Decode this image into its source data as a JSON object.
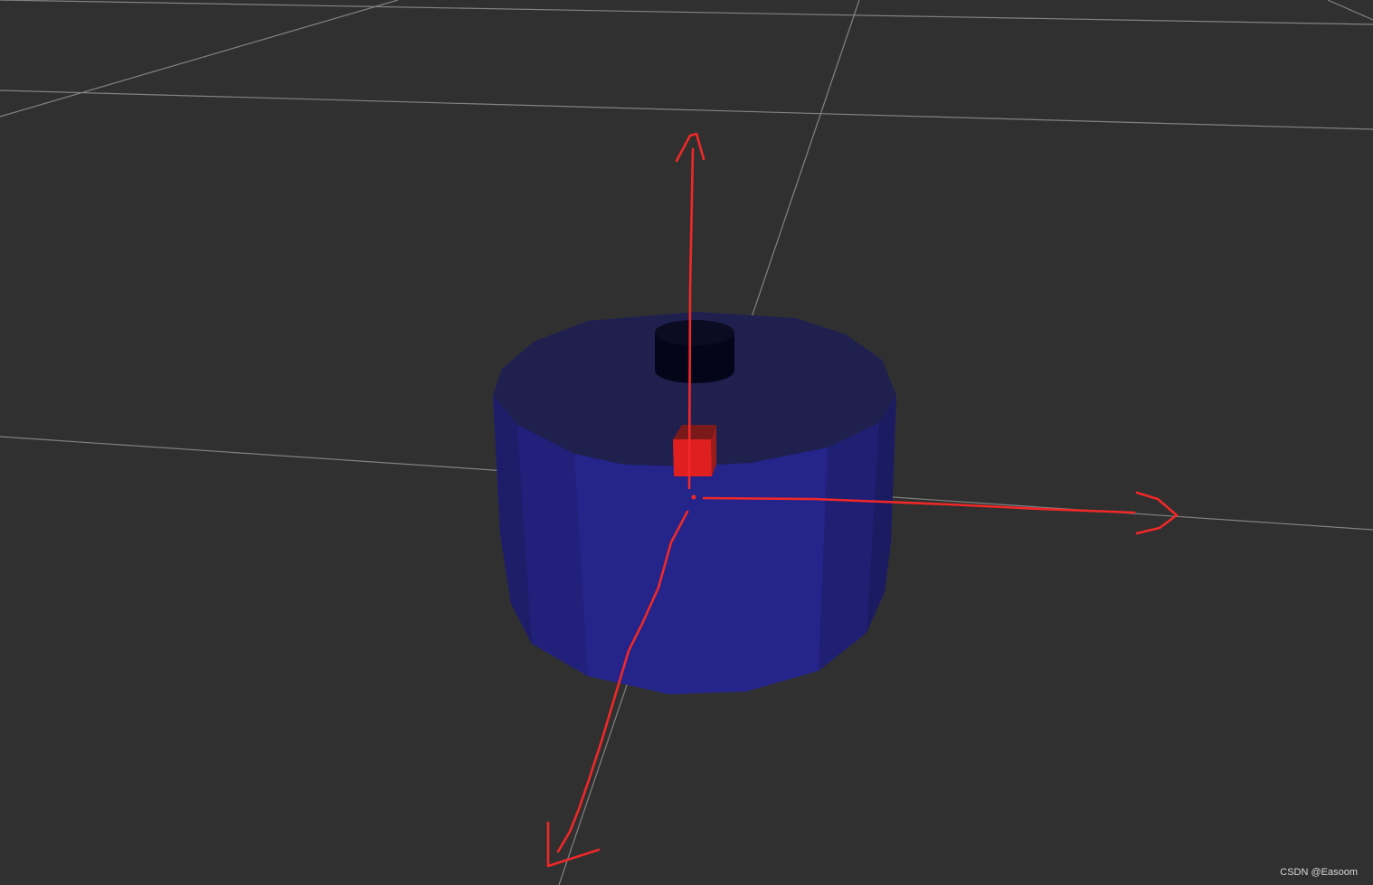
{
  "viewport": {
    "background_color": "#303030",
    "grid_color": "#8c8c8c"
  },
  "model": {
    "body_color": "#26268c",
    "top_color": "#20204f",
    "sensor_color": "#05051a",
    "marker_color": "#e01f1f"
  },
  "annotation": {
    "color": "#f02828",
    "axes": [
      "up-axis-arrow",
      "right-axis-arrow",
      "down-left-axis-arrow"
    ]
  },
  "watermark": {
    "text": "CSDN @Easoom"
  }
}
